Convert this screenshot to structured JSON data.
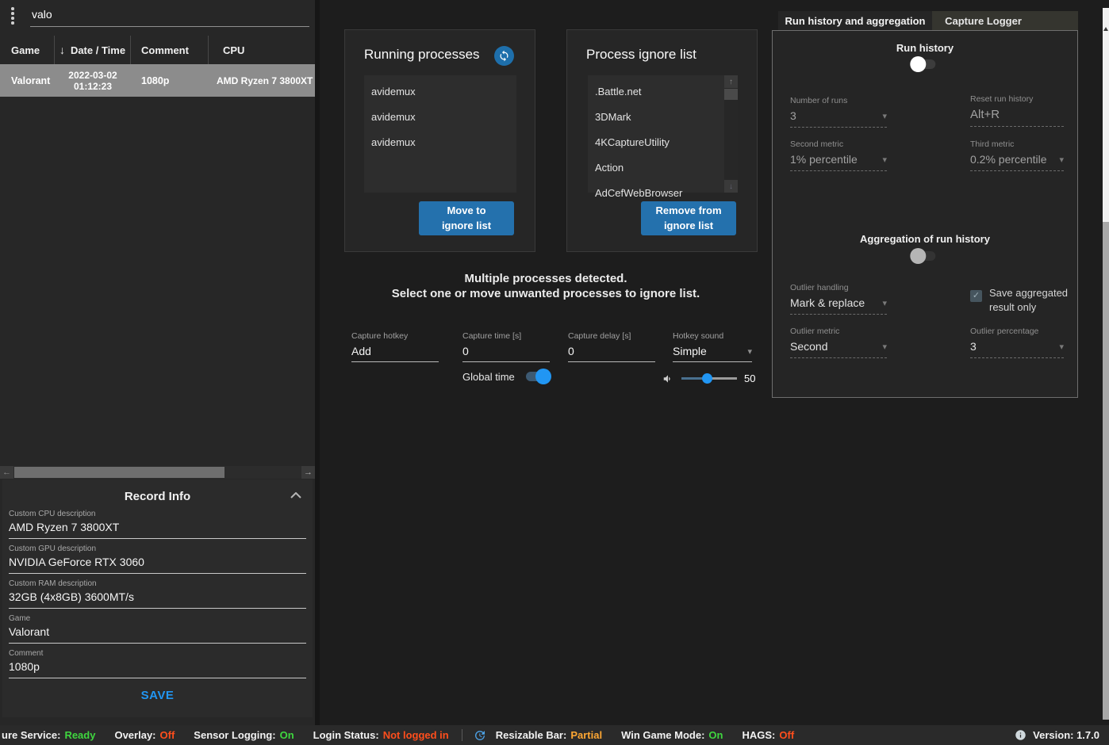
{
  "colors": {
    "accent_blue": "#2196f3",
    "button_blue": "#2471ad",
    "refresh_blue": "#1e6fab",
    "selected_row_gray": "#8c8c8c",
    "status_green": "#3fd63f",
    "status_red": "#ff4e1c",
    "status_orange": "#ffa733"
  },
  "icons": {
    "sort_desc": "↓",
    "scroll_left": "←",
    "scroll_right": "→",
    "scroll_up": "↑",
    "scroll_down": "↓",
    "dropdown_caret": "▾",
    "check": "✓"
  },
  "left_panel": {
    "search_value": "valo",
    "table": {
      "col_game": "Game",
      "col_datetime": "Date / Time",
      "col_comment": "Comment",
      "col_cpu": "CPU",
      "row": {
        "game": "Valorant",
        "date": "2022-03-02",
        "time": "01:12:23",
        "comment": "1080p",
        "cpu": "AMD Ryzen 7 3800XT"
      }
    },
    "record_info": {
      "title": "Record Info",
      "fields": [
        {
          "label": "Custom CPU description",
          "value": "AMD Ryzen 7 3800XT"
        },
        {
          "label": "Custom GPU description",
          "value": "NVIDIA GeForce RTX 3060"
        },
        {
          "label": "Custom RAM description",
          "value": "32GB (4x8GB) 3600MT/s"
        },
        {
          "label": "Game",
          "value": "Valorant"
        },
        {
          "label": "Comment",
          "value": "1080p"
        }
      ],
      "save_label": "SAVE"
    }
  },
  "processes": {
    "running": {
      "title": "Running processes",
      "items": [
        "avidemux",
        "avidemux",
        "avidemux"
      ],
      "button_line1": "Move to",
      "button_line2": "ignore list"
    },
    "ignore": {
      "title": "Process ignore list",
      "items": [
        ".Battle.net",
        "3DMark",
        "4KCaptureUtility",
        "Action",
        "AdCefWebBrowser"
      ],
      "button_line1": "Remove from",
      "button_line2": "ignore list"
    },
    "message_line1": "Multiple processes detected.",
    "message_line2": "Select one or move unwanted processes to ignore list."
  },
  "capture": {
    "hotkey_label": "Capture hotkey",
    "hotkey_value": "Add",
    "time_label": "Capture time [s]",
    "time_value": "0",
    "global_time_label": "Global time",
    "delay_label": "Capture delay [s]",
    "delay_value": "0",
    "sound_label": "Hotkey sound",
    "sound_value": "Simple",
    "volume_value": "50"
  },
  "right_panel": {
    "tab_run_history": "Run history and aggregation",
    "tab_capture_logger": "Capture Logger",
    "run_history": {
      "title": "Run history",
      "number_of_runs_label": "Number of runs",
      "number_of_runs_value": "3",
      "reset_label": "Reset run history",
      "reset_value": "Alt+R",
      "second_metric_label": "Second metric",
      "second_metric_value": "1% percentile",
      "third_metric_label": "Third metric",
      "third_metric_value": "0.2% percentile"
    },
    "aggregation": {
      "title": "Aggregation of run history",
      "outlier_handling_label": "Outlier handling",
      "outlier_handling_value": "Mark & replace",
      "save_aggregated_label_line1": "Save aggregated",
      "save_aggregated_label_line2": "result only",
      "outlier_metric_label": "Outlier metric",
      "outlier_metric_value": "Second",
      "outlier_percentage_label": "Outlier percentage",
      "outlier_percentage_value": "3"
    }
  },
  "status_bar": {
    "items": [
      {
        "label": "ure Service:",
        "value": "Ready",
        "color": "#3fd63f"
      },
      {
        "label": "Overlay:",
        "value": "Off",
        "color": "#ff4e1c"
      },
      {
        "label": "Sensor Logging:",
        "value": "On",
        "color": "#3fd63f"
      },
      {
        "label": "Login Status:",
        "value": "Not logged in",
        "color": "#ff4e1c"
      },
      {
        "label": "Resizable Bar:",
        "value": "Partial",
        "color": "#ffa733"
      },
      {
        "label": "Win Game Mode:",
        "value": "On",
        "color": "#3fd63f"
      },
      {
        "label": "HAGS:",
        "value": "Off",
        "color": "#ff4e1c"
      }
    ],
    "version": "Version: 1.7.0"
  }
}
